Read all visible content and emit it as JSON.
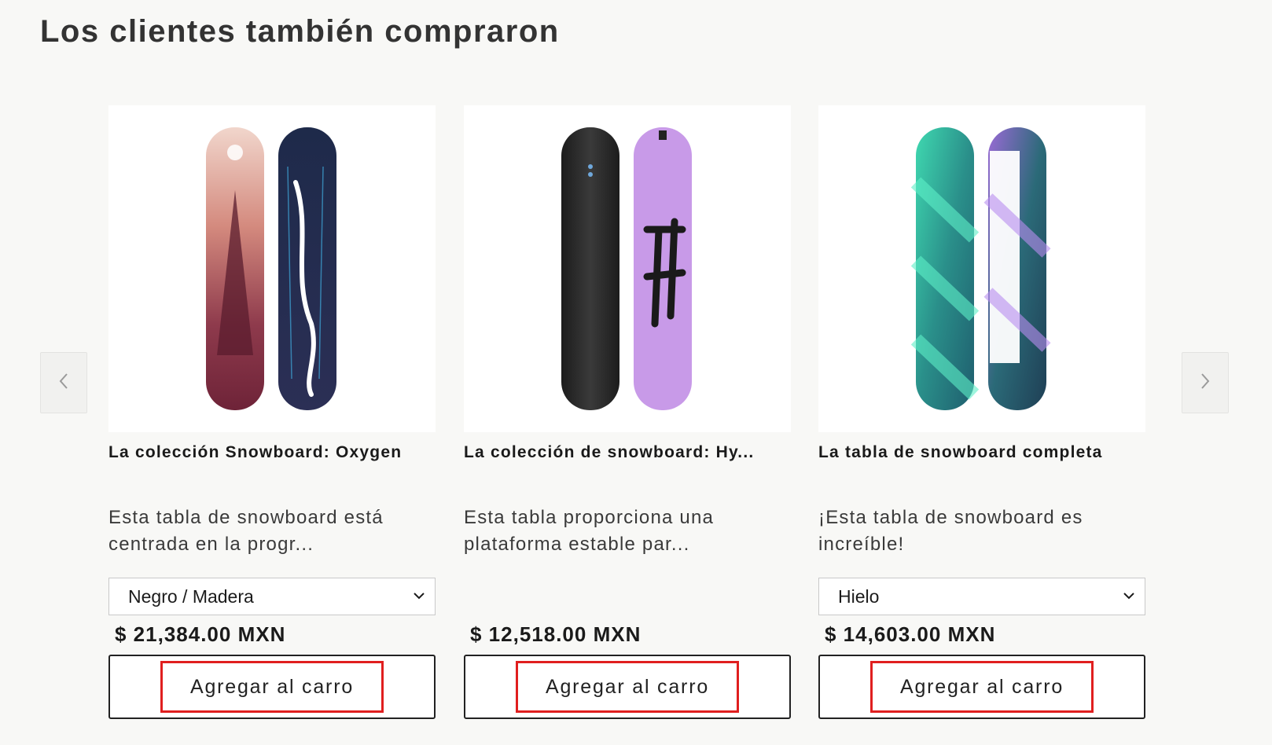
{
  "section": {
    "title": "Los clientes también compraron"
  },
  "carousel": {
    "prev_icon": "chevron-left-icon",
    "next_icon": "chevron-right-icon",
    "arrow_color": "#9a9a9a"
  },
  "colors": {
    "background": "#f8f8f6",
    "highlight_border": "#e01f1f",
    "button_border": "#222222"
  },
  "products": [
    {
      "title": "La colección Snowboard: Oxygen",
      "description": "Esta tabla de snowboard está centrada en la progr...",
      "variant": "Negro / Madera",
      "price": "$ 21,384.00 MXN",
      "button_label": "Agregar al carro",
      "image": "snowboard-oxygen-image"
    },
    {
      "title": "La colección de snowboard: Hy...",
      "description": "Esta tabla proporciona una plataforma estable par...",
      "variant": null,
      "price": "$ 12,518.00 MXN",
      "button_label": "Agregar al carro",
      "image": "snowboard-hydrogen-image"
    },
    {
      "title": "La tabla de snowboard completa",
      "description": "¡Esta tabla de snowboard es increíble!",
      "variant": "Hielo",
      "price": "$ 14,603.00 MXN",
      "button_label": "Agregar al carro",
      "image": "snowboard-complete-image"
    }
  ]
}
